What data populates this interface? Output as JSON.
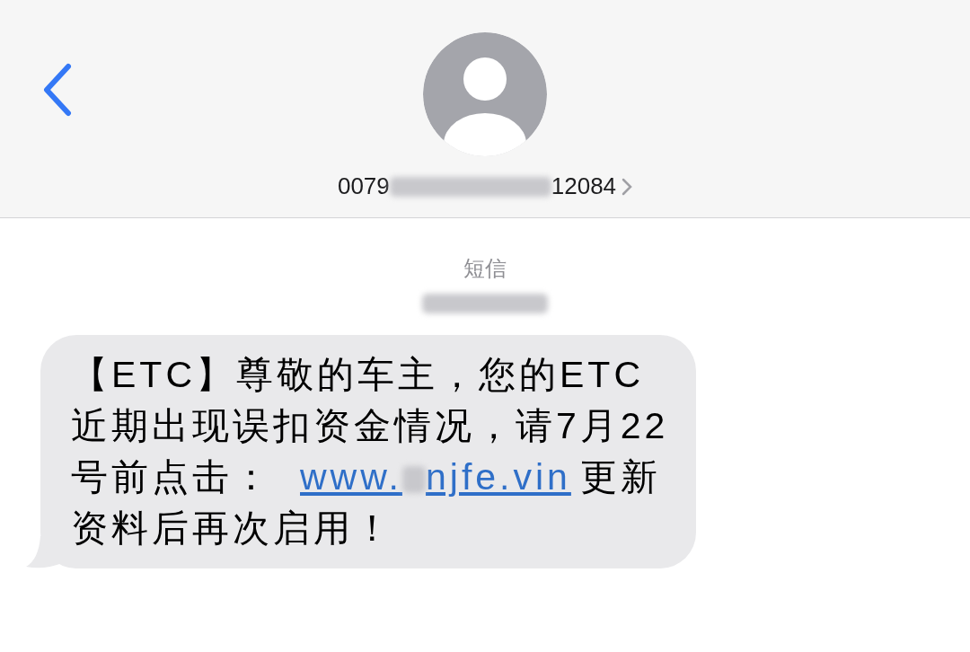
{
  "header": {
    "number_start": "0079",
    "number_redacted": true,
    "number_end": "12084"
  },
  "message": {
    "service": "短信",
    "timestamp_redacted": true,
    "text_before": "【ETC】尊敬的车主，您的ETC近期出现误扣资金情况，请7月22号前点击：",
    "link_start": "www.",
    "link_redacted": true,
    "link_end": "njfe.vin",
    "text_after": "更新资料后再次启用！"
  }
}
